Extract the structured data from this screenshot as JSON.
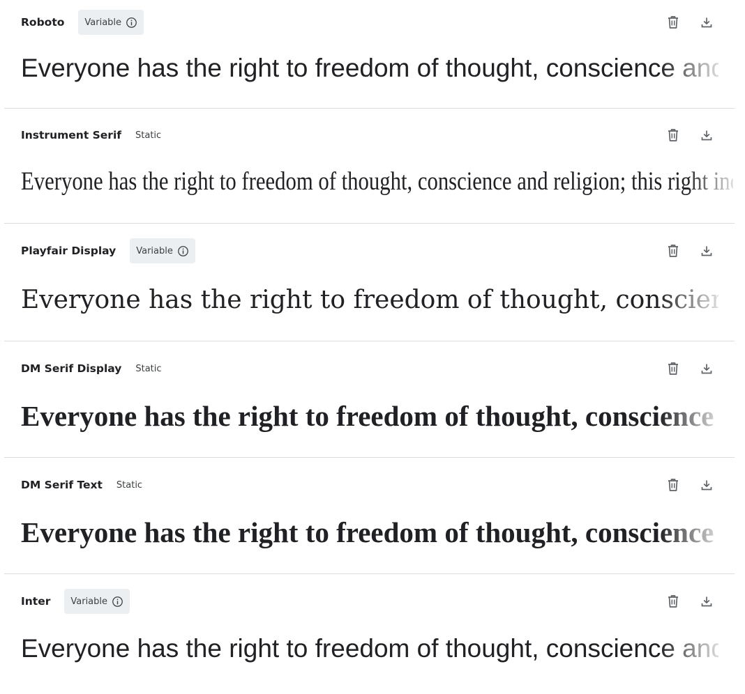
{
  "families": [
    {
      "name": "Roboto",
      "badge": "Variable",
      "sample": "Everyone has the right to freedom of thought, conscience and religion; this right includes freedom to change his religion or belief"
    },
    {
      "name": "Instrument Serif",
      "badge": "Static",
      "sample": "Everyone has the right to freedom of thought, conscience and religion; this right includes freedom to change his religion or belief"
    },
    {
      "name": "Playfair Display",
      "badge": "Variable",
      "sample": "Everyone has the right to freedom of thought, conscience and religion; this right includes freedom to change his religion or belief"
    },
    {
      "name": "DM Serif Display",
      "badge": "Static",
      "sample": "Everyone has the right to freedom of thought, conscience and religion; this right includes freedom to change his religion or belief"
    },
    {
      "name": "DM Serif Text",
      "badge": "Static",
      "sample": "Everyone has the right to freedom of thought, conscience and religion; this right includes freedom to change his religion or belief"
    },
    {
      "name": "Inter",
      "badge": "Variable",
      "sample": "Everyone has the right to freedom of thought, conscience and religion; this right includes freedom to change his religion or belief"
    }
  ],
  "icons": {
    "info": "info-icon",
    "remove": "trash-icon",
    "download": "download-icon"
  },
  "colors": {
    "text": "#202124",
    "badge_bg": "#eceff1",
    "divider": "#dadce0",
    "icon": "#5f6368"
  }
}
